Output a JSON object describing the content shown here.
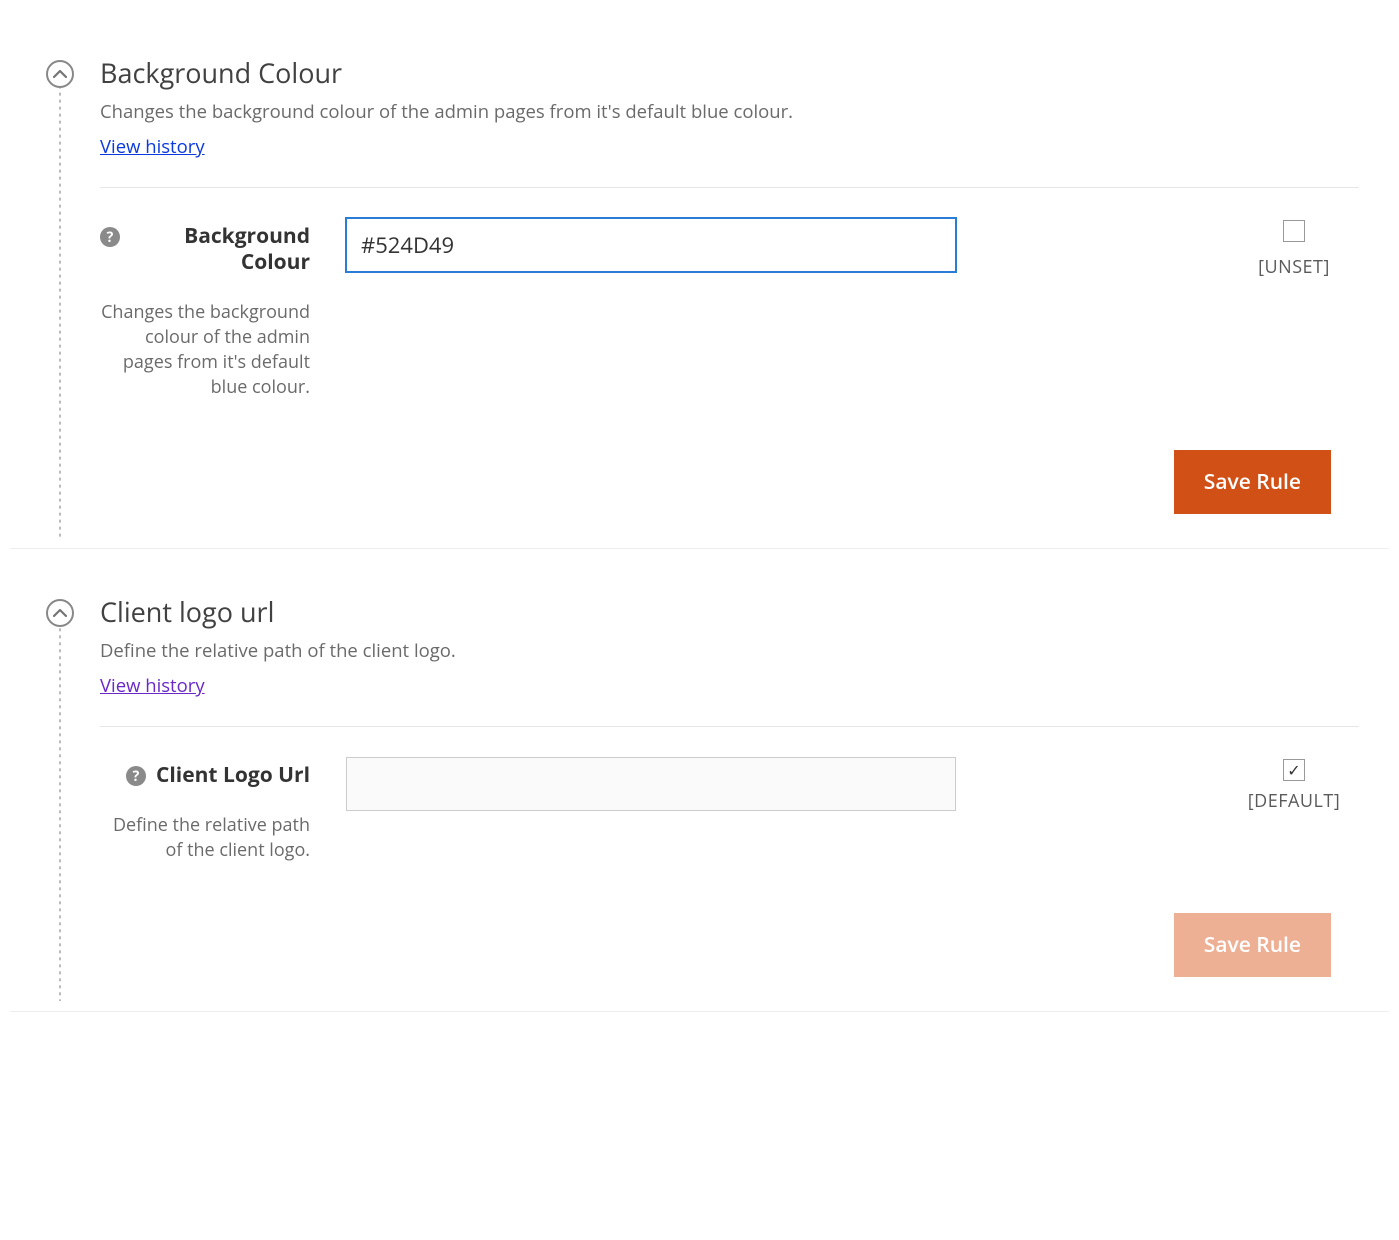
{
  "sections": {
    "bg": {
      "title": "Background Colour",
      "desc": "Changes the background colour of the admin pages from it's default blue colour.",
      "history_label": "View history",
      "field_label": "Background Colour",
      "field_desc": "Changes the background colour of the admin pages from it's default blue colour.",
      "input_value": "#524D49",
      "checkbox_checked": false,
      "status_label": "[UNSET]",
      "save_label": "Save Rule"
    },
    "logo": {
      "title": "Client logo url",
      "desc": "Define the relative path of the client logo.",
      "history_label": "View history",
      "field_label": "Client Logo Url",
      "field_desc": "Define the relative path of the client logo.",
      "input_value": "",
      "checkbox_checked": true,
      "status_label": "[DEFAULT]",
      "save_label": "Save Rule"
    }
  },
  "icons": {
    "help_glyph": "?"
  }
}
